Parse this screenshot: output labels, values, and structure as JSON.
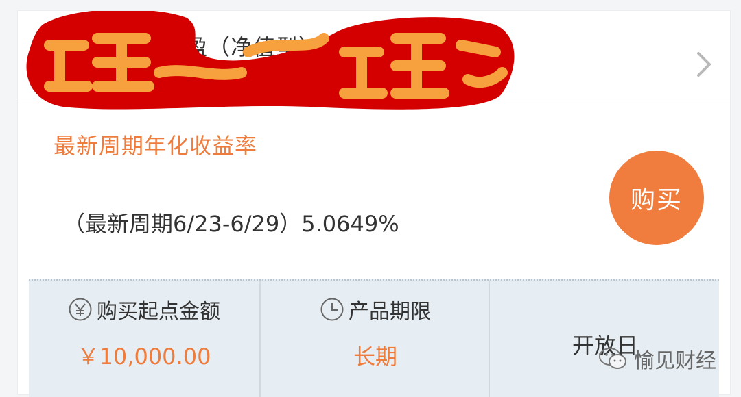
{
  "product": {
    "title": "周周盈（净值型）"
  },
  "yield": {
    "section_label": "最新周期年化收益率",
    "line": "（最新周期6/23-6/29）5.0649%"
  },
  "buy": {
    "label": "购买"
  },
  "info": [
    {
      "label": "购买起点金额",
      "value": "￥10,000.00",
      "icon": "yen-icon"
    },
    {
      "label": "产品期限",
      "value": "长期",
      "icon": "clock-icon"
    },
    {
      "label": "开放日",
      "value": "",
      "icon": ""
    }
  ],
  "watermark": {
    "text": "愉见财经",
    "icon": "wechat-icon"
  },
  "colors": {
    "accent": "#ee7c3d",
    "buy_button": "#f07c3e",
    "info_bg": "#e7eef3",
    "redaction": "#d40000"
  }
}
